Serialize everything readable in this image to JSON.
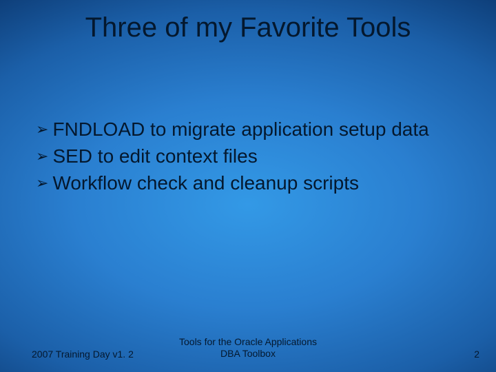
{
  "title": "Three of my Favorite Tools",
  "bullets": [
    "FNDLOAD to migrate application setup data",
    "SED to edit context files",
    "Workflow check and cleanup scripts"
  ],
  "footer": {
    "left": "2007 Training Day v1. 2",
    "center_line1": "Tools for the Oracle Applications",
    "center_line2": "DBA Toolbox",
    "page": "2"
  }
}
